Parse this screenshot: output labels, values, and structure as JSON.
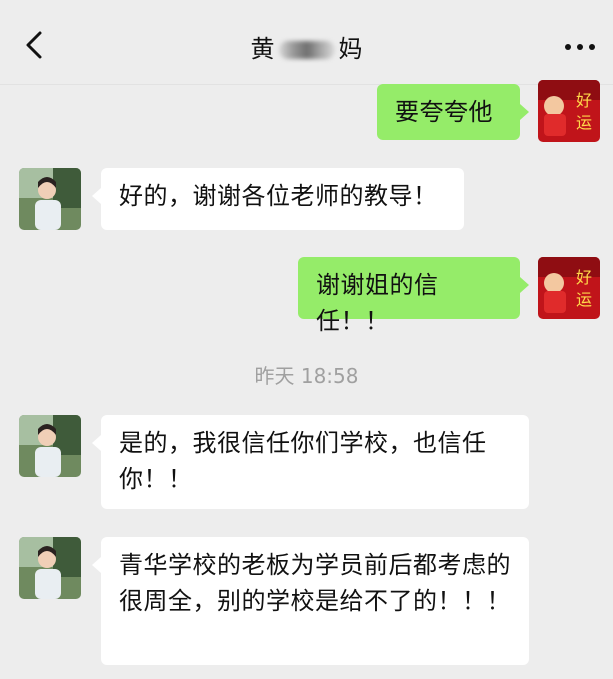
{
  "header": {
    "title_start": "黄",
    "title_end": "妈",
    "back_icon": "chevron-left-icon",
    "more_icon": "more-horizontal-icon"
  },
  "messages": [
    {
      "side": "out",
      "text": "要夸夸他"
    },
    {
      "side": "in",
      "text": "好的，谢谢各位老师的教导！"
    },
    {
      "side": "out",
      "text": "谢谢姐的信任！！"
    },
    {
      "side": "in",
      "text": "是的，我很信任你们学校，也信任你！！"
    },
    {
      "side": "in",
      "text": "青华学校的老板为学员前后都考虑的很周全，别的学校是给不了的！！！"
    }
  ],
  "timestamp": "昨天 18:58",
  "avatars": {
    "self_avatar_text": "好运",
    "contact_avatar": "avatar-photo"
  },
  "colors": {
    "background": "#ededed",
    "incoming_bubble": "#ffffff",
    "outgoing_bubble": "#95ec69"
  }
}
